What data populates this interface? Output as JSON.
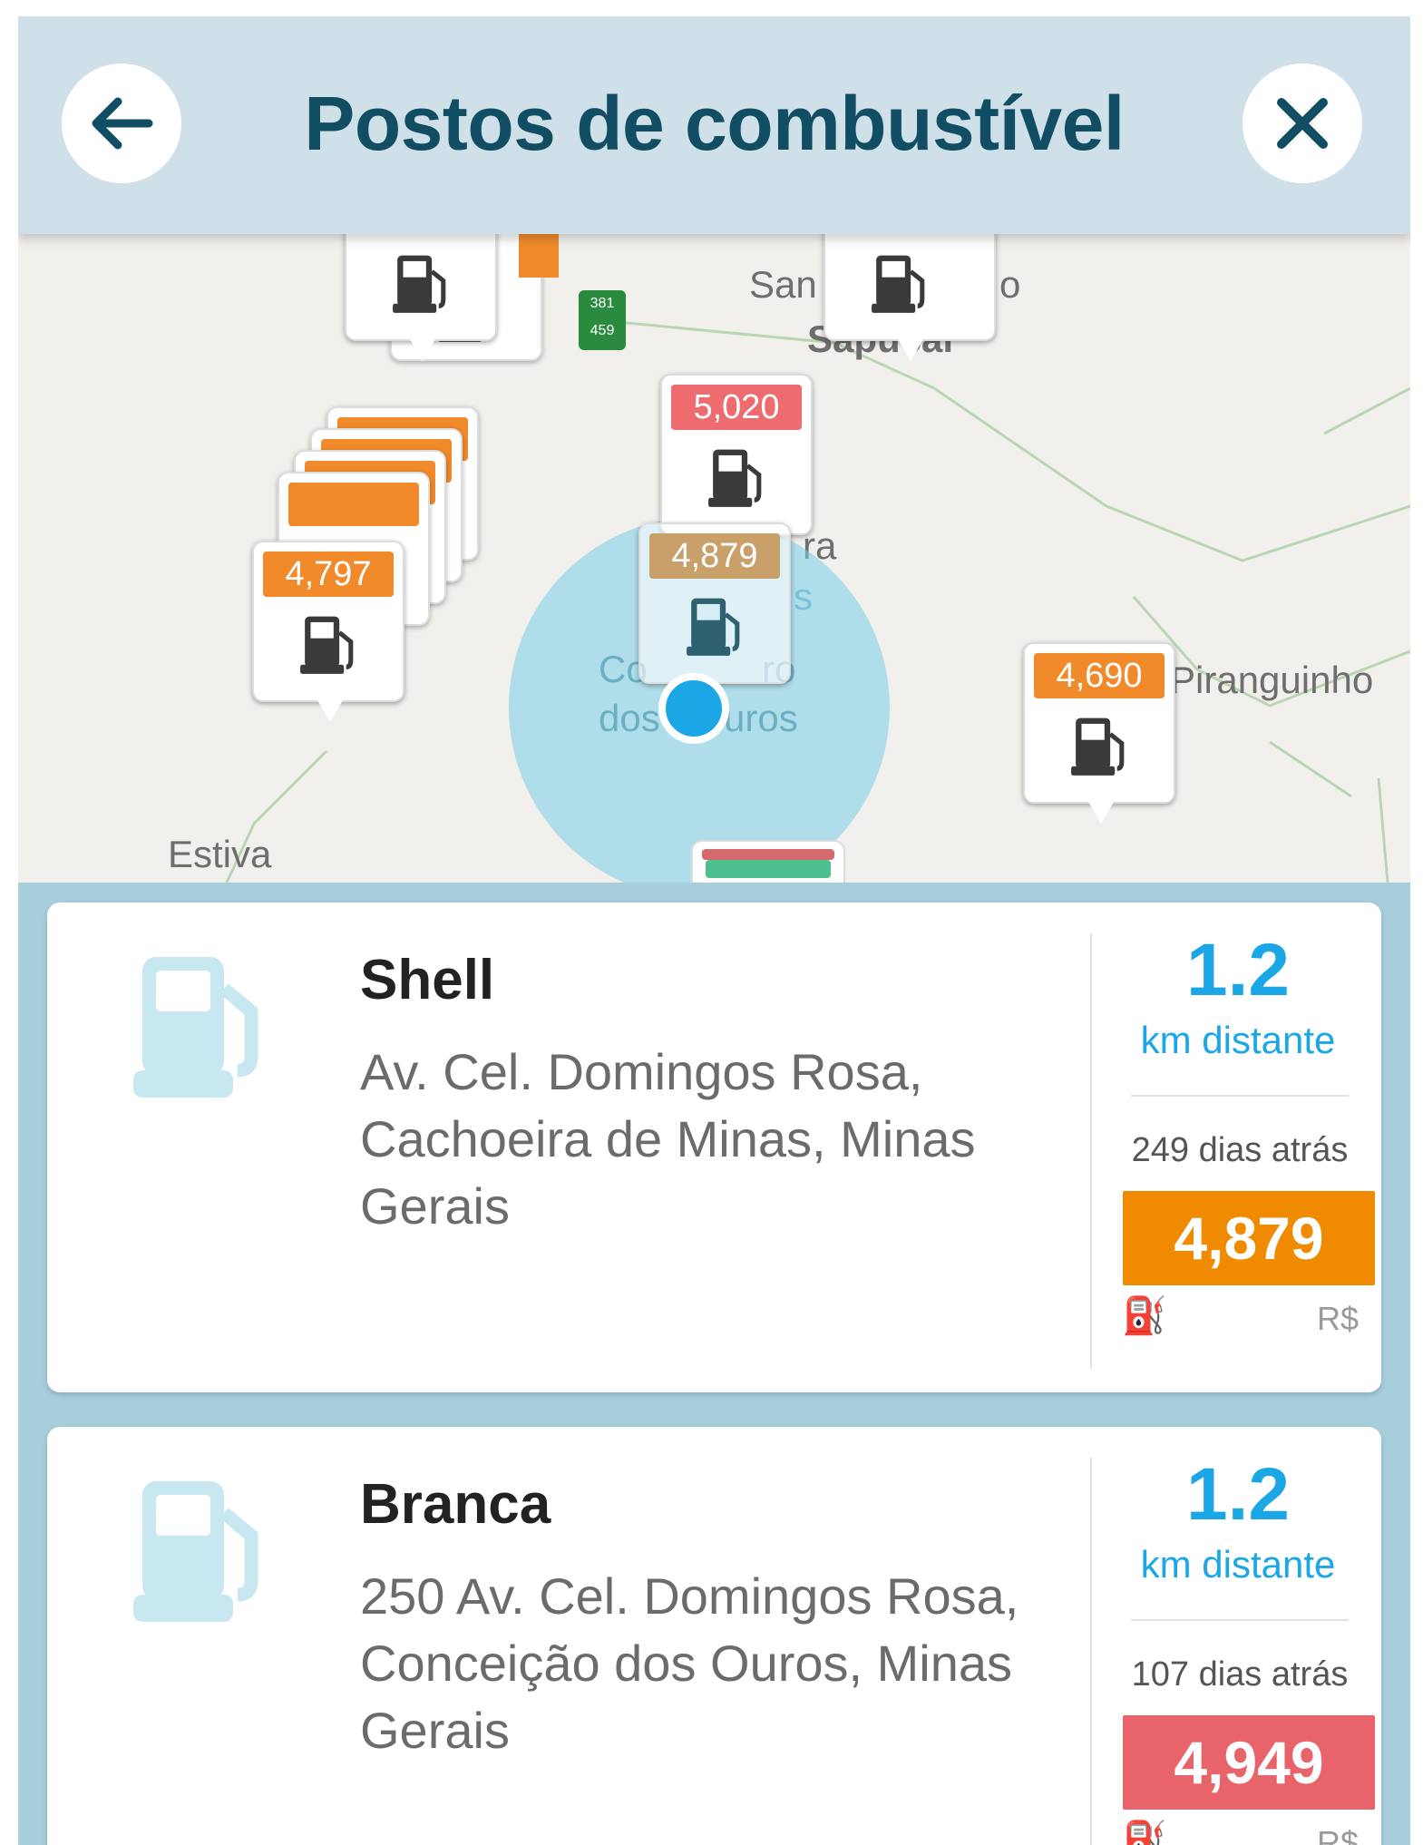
{
  "header": {
    "title": "Postos de combustível",
    "back_icon": "arrow-left-icon",
    "close_icon": "close-icon"
  },
  "map": {
    "labels": [
      "San",
      "o",
      "Sapucaí",
      "ra",
      "s",
      "Co",
      "ro",
      "dos",
      "uros",
      "Piranguinho",
      "Estiva"
    ],
    "route_shield": [
      "381",
      "459"
    ],
    "markers": [
      {
        "price": "5,020",
        "color": "#ee6b6f"
      },
      {
        "price": "4,879",
        "color": "#c9a06a"
      },
      {
        "price": "4,797",
        "color": "#f08a2b"
      },
      {
        "price": "4,690",
        "color": "#f08a2b"
      }
    ]
  },
  "stations": [
    {
      "name": "Shell",
      "address": "Av. Cel. Domingos Rosa, Cachoeira de Minas, Minas Gerais",
      "distance": "1.2",
      "distance_unit": "km distante",
      "updated": "249 dias atrás",
      "price": "4,879",
      "price_color": "#f08a00",
      "currency": "R$"
    },
    {
      "name": "Branca",
      "address": "250 Av. Cel. Domingos Rosa, Conceição dos Ouros, Minas Gerais",
      "distance": "1.2",
      "distance_unit": "km distante",
      "updated": "107 dias atrás",
      "price": "4,949",
      "price_color": "#e8646a",
      "currency": "R$"
    }
  ]
}
